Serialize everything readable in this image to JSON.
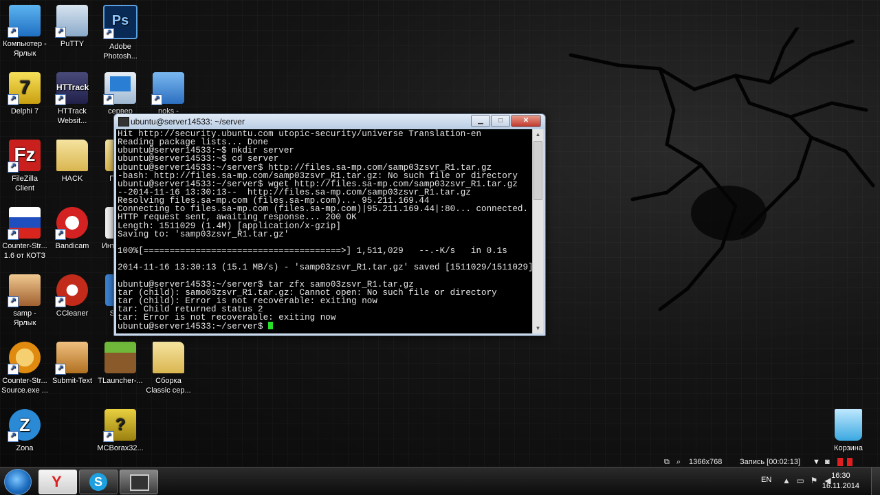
{
  "desktop_icons": [
    {
      "name": "computer-shortcut",
      "label": "Компьютер - Ярлык",
      "icon": "computer-icon",
      "color": "#2d8ad6"
    },
    {
      "name": "putty",
      "label": "PuTTY",
      "icon": "putty-icon",
      "color": "#8aa9c9"
    },
    {
      "name": "photoshop",
      "label": "Adobe Photosh...",
      "icon": "photoshop-icon",
      "color": "#0a2a56"
    },
    {
      "name": "delphi",
      "label": "Delphi 7",
      "icon": "delphi-icon",
      "color": "#e0c020"
    },
    {
      "name": "httrack",
      "label": "HTTrack Websit...",
      "icon": "httrack-icon",
      "color": "#2a2a5a"
    },
    {
      "name": "server",
      "label": "сервер",
      "icon": "monitor-icon",
      "color": "#2a7fd4"
    },
    {
      "name": "noks",
      "label": "noks -",
      "icon": "network-icon",
      "color": "#3b82d8"
    },
    {
      "name": "filezilla",
      "label": "FileZilla Client",
      "icon": "filezilla-icon",
      "color": "#c9201e"
    },
    {
      "name": "hack",
      "label": "HACK",
      "icon": "folder-icon",
      "color": "#e6c659"
    },
    {
      "name": "counter-strike-16",
      "label": "Counter-Str... 1.6 от КОТЗ",
      "icon": "russian-flag-icon",
      "color": "#d8261e"
    },
    {
      "name": "bandicam",
      "label": "Bandicam",
      "icon": "bandicam-icon",
      "color": "#d42222"
    },
    {
      "name": "samp",
      "label": "samp - Ярлык",
      "icon": "samp-icon",
      "color": "#d0a060"
    },
    {
      "name": "ccleaner",
      "label": "CCleaner",
      "icon": "ccleaner-icon",
      "color": "#c22a1a"
    },
    {
      "name": "counter-strike-source",
      "label": "Counter-Str... Source.exe ...",
      "icon": "cs-source-icon",
      "color": "#e8a020"
    },
    {
      "name": "submit-text",
      "label": "Submit-Text",
      "icon": "submit-text-icon",
      "color": "#d09030"
    },
    {
      "name": "tlauncher",
      "label": "TLauncher-...",
      "icon": "minecraft-icon",
      "color": "#5a8a2a"
    },
    {
      "name": "sborka",
      "label": "Сборка Classic сер...",
      "icon": "folder-icon",
      "color": "#e6c659"
    },
    {
      "name": "zona",
      "label": "Zona",
      "icon": "zona-icon",
      "color": "#2a8ad6"
    },
    {
      "name": "mcborax",
      "label": "MCBorax32...",
      "icon": "mcborax-icon",
      "color": "#c9b020"
    },
    {
      "name": "recycle-bin",
      "label": "Корзина",
      "icon": "recycle-bin-icon",
      "color": "#3aa8e0"
    }
  ],
  "partial_labels": {
    "p1": "П",
    "p2": "Инт",
    "p3": "S"
  },
  "terminal": {
    "title": "ubuntu@server14533: ~/server",
    "lines": [
      "Hit http://security.ubuntu.com utopic-security/universe Translation-en",
      "Reading package lists... Done",
      "ubuntu@server14533:~$ mkdir server",
      "ubuntu@server14533:~$ cd server",
      "ubuntu@server14533:~/server$ http://files.sa-mp.com/samp03zsvr_R1.tar.gz",
      "-bash: http://files.sa-mp.com/samp03zsvr_R1.tar.gz: No such file or directory",
      "ubuntu@server14533:~/server$ wget http://files.sa-mp.com/samp03zsvr_R1.tar.gz",
      "--2014-11-16 13:30:13--  http://files.sa-mp.com/samp03zsvr_R1.tar.gz",
      "Resolving files.sa-mp.com (files.sa-mp.com)... 95.211.169.44",
      "Connecting to files.sa-mp.com (files.sa-mp.com)|95.211.169.44|:80... connected.",
      "HTTP request sent, awaiting response... 200 OK",
      "Length: 1511029 (1.4M) [application/x-gzip]",
      "Saving to: 'samp03zsvr_R1.tar.gz'",
      "",
      "100%[======================================>] 1,511,029   --.-K/s   in 0.1s",
      "",
      "2014-11-16 13:30:13 (15.1 MB/s) - 'samp03zsvr_R1.tar.gz' saved [1511029/1511029]",
      "",
      "ubuntu@server14533:~/server$ tar zfx samo03zsvr_R1.tar.gz",
      "tar (child): samo03zsvr_R1.tar.gz: Cannot open: No such file or directory",
      "tar (child): Error is not recoverable: exiting now",
      "tar: Child returned status 2",
      "tar: Error is not recoverable: exiting now"
    ],
    "prompt": "ubuntu@server14533:~/server$ ",
    "cursor_color": "#27e027"
  },
  "recorder": {
    "resolution": "1366x768",
    "recording": "Запись [00:02:13]"
  },
  "tray": {
    "language": "EN",
    "time": "16:30",
    "date": "16.11.2014"
  }
}
